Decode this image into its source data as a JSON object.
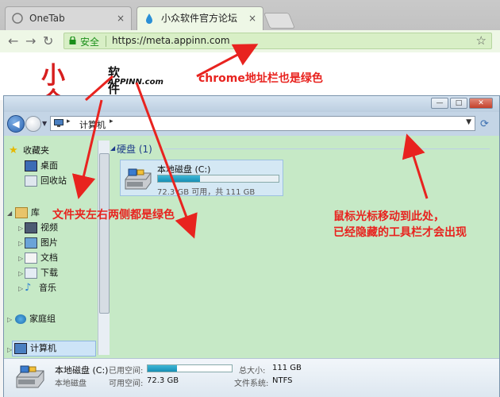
{
  "browser": {
    "tabs": [
      {
        "label": "OneTab",
        "icon": "onetab-icon",
        "close": "×"
      },
      {
        "label": "小众软件官方论坛",
        "icon": "waterdrop-icon",
        "close": "×"
      }
    ],
    "omnibox": {
      "secure_label": "安全",
      "url": "https://meta.appinn.com"
    },
    "accent_green": "#d8efc6"
  },
  "site": {
    "logo_main": "小众",
    "logo_word": "软件",
    "logo_domain": "APPINN.com"
  },
  "annotations": {
    "chrome_note": "chrome地址栏也是绿色",
    "folder_note": "文件夹左右两侧都是绿色",
    "hover_note_1": "鼠标光标移动到此处，",
    "hover_note_2": "已经隐藏的工具栏才会出现",
    "color": "#e8231f"
  },
  "explorer": {
    "window_buttons": [
      "—",
      "□",
      "✕"
    ],
    "address": {
      "path": "计算机"
    },
    "nav": {
      "favorites": "收藏夹",
      "desktop": "桌面",
      "recycle": "回收站",
      "libraries": "库",
      "videos": "视频",
      "pictures": "图片",
      "documents": "文档",
      "downloads": "下载",
      "music": "音乐",
      "homegroup": "家庭组",
      "computer": "计算机"
    },
    "group_header": "硬盘 (1)",
    "drive": {
      "name": "本地磁盘 (C:)",
      "info": "72.3 GB 可用，共 111 GB",
      "used_fraction": 0.35
    },
    "details": {
      "name": "本地磁盘 (C:)",
      "type": "本地磁盘",
      "used_key": "已用空间:",
      "free_key": "可用空间:",
      "free_val": "72.3 GB",
      "total_key": "总大小:",
      "total_val": "111 GB",
      "fs_key": "文件系统:",
      "fs_val": "NTFS"
    },
    "body_green": "#c6e9c6"
  }
}
